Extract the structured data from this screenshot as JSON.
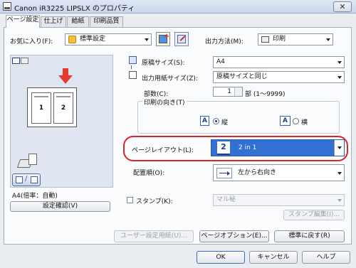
{
  "window": {
    "title": "Canon iR3225 LIPSLX のプロパティ",
    "close_label": "✕"
  },
  "tabs": [
    {
      "label": "ページ設定",
      "active": true
    },
    {
      "label": "仕上げ",
      "active": false
    },
    {
      "label": "給紙",
      "active": false
    },
    {
      "label": "印刷品質",
      "active": false
    }
  ],
  "favorites": {
    "label": "お気に入り(F):",
    "value": "標準設定"
  },
  "output_method": {
    "label": "出力方法(M):",
    "value": "印刷"
  },
  "preview": {
    "page1": "1",
    "page2": "2",
    "info": "A4(倍率：自動)",
    "confirm_button": "設定確認(V)"
  },
  "original_size": {
    "label": "原稿サイズ(S):",
    "value": "A4"
  },
  "output_paper_size": {
    "label": "出力用紙サイズ(Z):",
    "value": "原稿サイズと同じ"
  },
  "copies": {
    "label": "部数(C):",
    "value": "1",
    "suffix": "部 (1～9999)"
  },
  "orientation": {
    "group_label": "印刷の向き(T)",
    "portrait": "縦",
    "landscape": "横",
    "selected": "portrait"
  },
  "page_layout": {
    "label": "ページレイアウト(L):",
    "icon_text": "2",
    "value": "2 in 1"
  },
  "page_order": {
    "label": "配置順(O):",
    "value": "左から右向き"
  },
  "stamp": {
    "label": "スタンプ(K):",
    "value": "マル秘",
    "checked": false,
    "edit_button": "スタンプ編集(I)..."
  },
  "bottom_buttons": {
    "user_paper": "ユーザー設定用紙(U)...",
    "page_options": "ページオプション(E)...",
    "restore": "標準に戻す(R)"
  },
  "dialog_buttons": {
    "ok": "OK",
    "cancel": "キャンセル",
    "help": "ヘルプ"
  },
  "colors": {
    "highlight_red": "#d4262c",
    "selection_blue": "#3270d4"
  }
}
